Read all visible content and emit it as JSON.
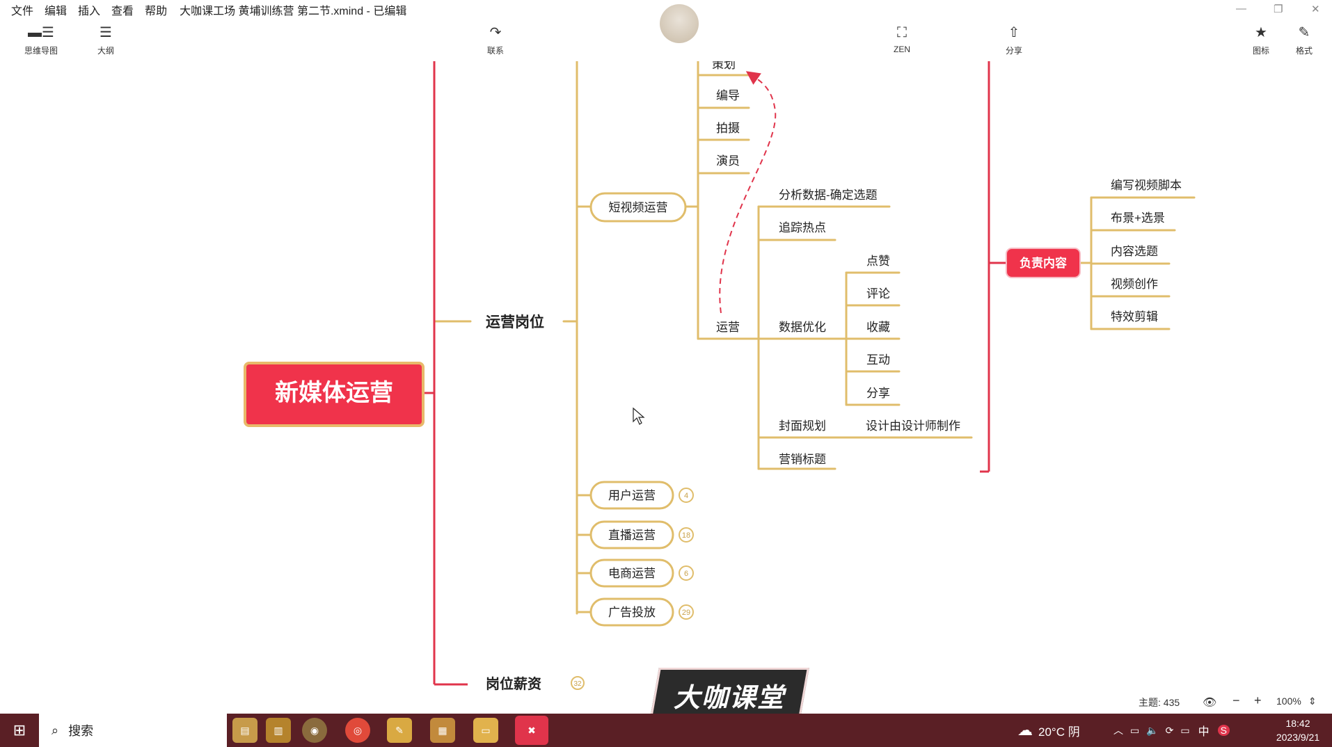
{
  "menu": {
    "file": "文件",
    "edit": "编辑",
    "insert": "插入",
    "view": "查看",
    "help": "帮助",
    "title": "大咖课工场 黄埔训练营 第二节.xmind - 已编辑"
  },
  "toolbar": {
    "mindmap": "思维导图",
    "outline": "大纲",
    "relationship": "联系",
    "zen": "ZEN",
    "share": "分享",
    "icons": "图标",
    "format": "格式"
  },
  "mindmap": {
    "root": "新媒体运营",
    "main_branch": "运营岗位",
    "main_branch2": "岗位薪资",
    "short_video": "短视频运营",
    "sv_children": [
      "策划",
      "编导",
      "拍摄",
      "演员",
      "运营"
    ],
    "ops_children": [
      "分析数据-确定选题",
      "追踪热点",
      "数据优化",
      "封面规划",
      "营销标题"
    ],
    "data_opt_children": [
      "点赞",
      "评论",
      "收藏",
      "互动",
      "分享"
    ],
    "cover_detail": "设计由设计师制作",
    "other_roles": [
      {
        "label": "用户运营",
        "count": "4"
      },
      {
        "label": "直播运营",
        "count": "18"
      },
      {
        "label": "电商运营",
        "count": "6"
      },
      {
        "label": "广告投放",
        "count": "29"
      }
    ],
    "salary_count": "32",
    "callout": "负责内容",
    "callout_children": [
      "编写视频脚本",
      "布景+选景",
      "内容选题",
      "视频创作",
      "特效剪辑"
    ]
  },
  "watermark": "大咖课堂",
  "status": {
    "topics": "主题: 435",
    "zoom": "100%"
  },
  "taskbar": {
    "search": "搜索",
    "weather": "20°C 阴",
    "ime": "中",
    "time": "18:42",
    "date": "2023/9/21"
  },
  "colors": {
    "branch": "#e0bd6b",
    "root": "#f0334b",
    "root_border": "#e8b96a",
    "spine": "#e0344b",
    "taskbar": "#5a1f25"
  }
}
